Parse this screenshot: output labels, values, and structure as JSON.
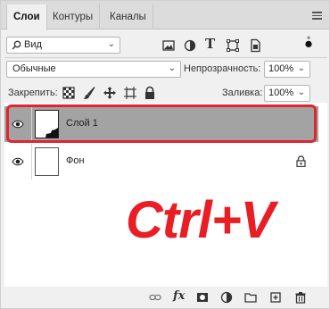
{
  "tabs": [
    {
      "label": "Слои"
    },
    {
      "label": "Контуры"
    },
    {
      "label": "Каналы"
    }
  ],
  "filter": {
    "label": "Вид"
  },
  "blend_mode": {
    "value": "Обычные"
  },
  "opacity": {
    "label": "Непрозрачность:",
    "value": "100%"
  },
  "lock": {
    "label": "Закрепить:"
  },
  "fill": {
    "label": "Заливка:",
    "value": "100%"
  },
  "layers": [
    {
      "name": "Слой 1",
      "selected": true
    },
    {
      "name": "Фон",
      "selected": false
    }
  ],
  "overlay": {
    "hotkey": "Ctrl+V",
    "color": "#ea1c24",
    "highlight_color": "#e0252f"
  },
  "footer": {
    "fx_label": "fx"
  }
}
